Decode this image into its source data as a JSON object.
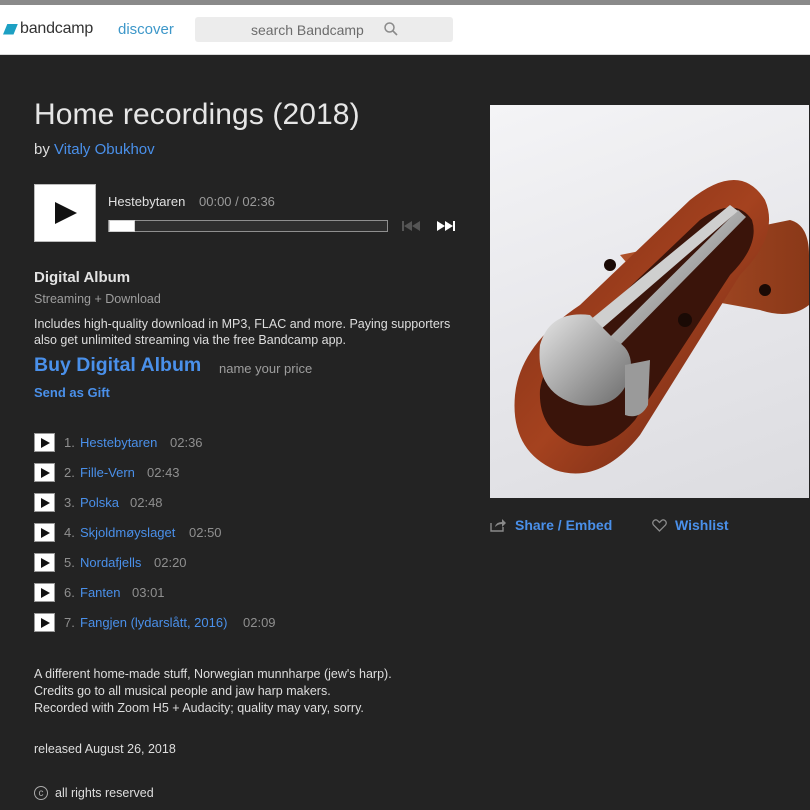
{
  "header": {
    "logo_text": "bandcamp",
    "discover_label": "discover",
    "search_placeholder": "search Bandcamp"
  },
  "album": {
    "title": "Home recordings (2018)",
    "by_prefix": "by",
    "artist": "Vitaly Obukhov"
  },
  "player": {
    "current_track": "Hestebytaren",
    "time": "00:00 / 02:36",
    "progress": 0
  },
  "purchase": {
    "format_title": "Digital Album",
    "format_sub": "Streaming + Download",
    "description": "Includes high-quality download in MP3, FLAC and more. Paying supporters also get unlimited streaming via the free Bandcamp app.",
    "buy_label": "Buy Digital Album",
    "price_note": "name your price",
    "gift_label": "Send as Gift"
  },
  "tracks": [
    {
      "num": "1.",
      "name": "Hestebytaren",
      "duration": "02:36"
    },
    {
      "num": "2.",
      "name": "Fille-Vern",
      "duration": "02:43"
    },
    {
      "num": "3.",
      "name": "Polska",
      "duration": "02:48"
    },
    {
      "num": "4.",
      "name": "Skjoldmøyslaget",
      "duration": "02:50"
    },
    {
      "num": "5.",
      "name": "Nordafjells",
      "duration": "02:20"
    },
    {
      "num": "6.",
      "name": "Fanten",
      "duration": "03:01"
    },
    {
      "num": "7.",
      "name": "Fangjen (lydarslått, 2016)",
      "duration": "02:09"
    }
  ],
  "about": {
    "line1": "A different home-made stuff, Norwegian munnharpe (jew's harp).",
    "line2": "Credits go to all musical people and jaw harp makers.",
    "line3": "Recorded with Zoom H5 + Audacity; quality may vary, sorry."
  },
  "released": "released August 26, 2018",
  "rights": "all rights reserved",
  "actions": {
    "share_label": "Share / Embed",
    "wishlist_label": "Wishlist"
  },
  "colors": {
    "link": "#4a90ea",
    "background": "#232323",
    "logo": "#1da0c3"
  }
}
